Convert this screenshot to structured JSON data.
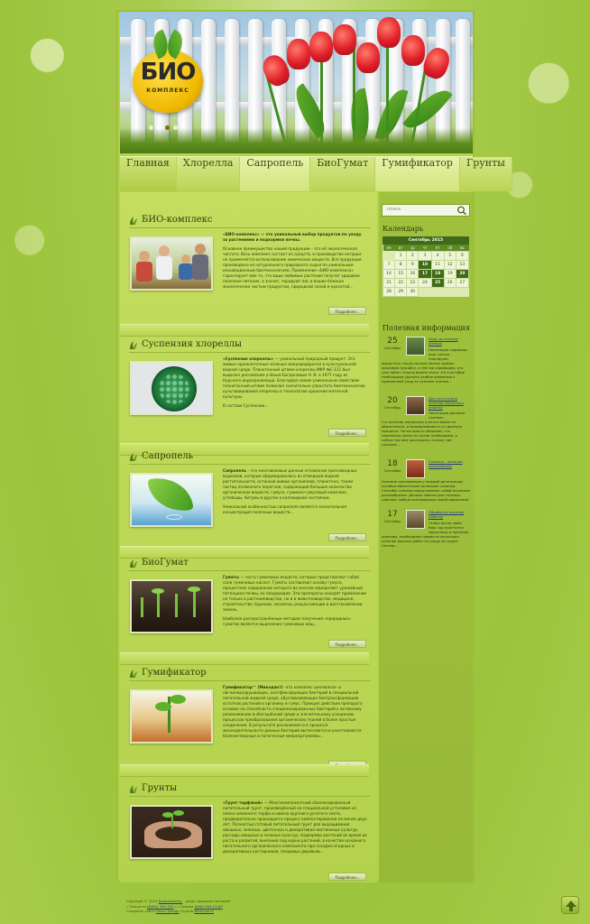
{
  "logo": {
    "text": "БИО",
    "subtext": "КОМПЛЕКС"
  },
  "nav": [
    "Главная",
    "Хлорелла",
    "Сапропель",
    "БиоГумат",
    "Гумификатор",
    "Грунты"
  ],
  "sections": [
    {
      "title": "БИО-комплекс",
      "lead": "«БИО-комплекс» — это уникальный выбор продуктов по уходу за растениями и подкормки почвы.",
      "body": "Основное преимущество нашей продукции – это её экологическая чистота. Весь комплекс состоит из средств, в производстве которых не применяется использование химических веществ. Вся продукция производена из натурального природного сырья по уникальным инновационным биотехнологиям. Применение «БИО-комплекса» гарантирует вам то, что ваши любимые растения получат здоровое полезное питание, а значит, порадуют вас и ваших близких экологически чистым продуктом, природной силой и красотой...",
      "more": "Подробнее..."
    },
    {
      "title": "Суспензия хлореллы",
      "lead": "«Суспензия хлореллы»",
      "body": " — уникальный природный продукт. Это живые одноклеточные зеленые микроводоросли в культуральной водной среде. Планктонный штамм хлореллы ИФР №С-111 был выделен российским учёным Богдановым Н. И. в 1977 году из Нурского водохранилища. Благодаря своим уникальным свойствам планктонный штамм позволил значительно упростить биотехнологию культивирования хлореллы и технологию хранения маточной культуры.",
      "body2": "В составе Суспензии...",
      "more": "Подробнее..."
    },
    {
      "title": "Сапропель",
      "lead": "Сапропель",
      "body": " – это многовековые донные отложения пресноводных водоемов, которые сформировались из отмершей водной растительности, останков живых организмов, планктона, также частиц почвенного перегноя, содержащий большое количество органических веществ, гумуса, гуминно-гумусовый комплекс, углеводы, битумы в другие в коллоидном состоянии.",
      "body2": "Уникальной особенностью сапропеля является значительная концентрация полезных веществ...",
      "more": "Подробнее..."
    },
    {
      "title": "БиоГумат",
      "lead": "Гуматы",
      "body": " — часть гуминовых веществ, которые представляют собой соли гуминовых кислот. Гуматы составляют основу гумуса, процентное содержание которого во многом определяет урожайный потенциал почвы, ее плодородие. Эти препараты находят применение не только в растениеводстве, но и в животноводстве, медицине, строительстве, бурении, экологии, рекультивации и восстановлении земель.",
      "body2": "Наиболее распространённым методом получения «природных» гуматов является выделение гуминовых вещ...",
      "more": "Подробнее..."
    },
    {
      "title": "Гумификатор",
      "lead": "Гумификатор™ (Микодакт)",
      "body": " –это комплекс целлюлозо- и лигниноразрушающих, азотфиксирующих бактерий в специальной питательной жидкой среде, обуславливающих биотрансформацию остатков растений в органику и гумус. Принцип действия препарата основан на способности специализированных бактерий к активному размножению в обогащённой среде и значительному ускорению процессов преобразования органических тканей в более простые соединения. В результате разложения и в процессе жизнедеятельности данных бактерий вытесняются и уничтожаются болезнетворные и патогенные микроорганизмы...",
      "more": "Подробнее..."
    },
    {
      "title": "Грунты",
      "lead": "«Грунт торфяной»",
      "body": " — Многокомпонентный сбалансированный питательный грунт, произведённый на специальной установке из смеси низинного торфа и навоза крупного рогатого скота, предварительно прошедшего процесс компостирования не менее двух лет. Полностью готовый питательный грунт для выращивания овощных, зеленых, цветочных и декоративно-лиственных культур, рассады овощных и зеленых культур, подкормки растений во время их роста и развития, внесения под корни растений, в качестве основного питательного органического компонента при посадки ягодных и декоративных кустарников, плодовых деревьев...",
      "more": "Подробнее..."
    }
  ],
  "sidebar": {
    "search_placeholder": "поиск",
    "calendar_title": "Календарь",
    "month": "Сентябрь 2015",
    "weekdays": [
      "пн",
      "вт",
      "ср",
      "чт",
      "пт",
      "сб",
      "вс"
    ],
    "weeks": [
      [
        "",
        "1",
        "2",
        "3",
        "4",
        "5",
        "6"
      ],
      [
        "7",
        "8",
        "9",
        "10",
        "11",
        "12",
        "13"
      ],
      [
        "14",
        "15",
        "16",
        "17",
        "18",
        "19",
        "20"
      ],
      [
        "21",
        "22",
        "23",
        "24",
        "25",
        "26",
        "27"
      ],
      [
        "28",
        "29",
        "30",
        "",
        "",
        "",
        ""
      ]
    ],
    "highlighted_days": [
      "10",
      "17",
      "18",
      "20",
      "25"
    ],
    "news_title": "Полезная информация",
    "news": [
      {
        "day": "25",
        "month": "Сентябрь",
        "title": "Уход за газоном осенью",
        "side": "Некоторые садоводы еще только планируют",
        "text": "вырастить такую сочную зелень домом красивую лужайку, а тем же садоводам, кто уже имеет газоны важно знать что в октябре необходимо уделить особое внимание к правильный уход за газоном осенью...",
        "color": "#7a9a4a"
      },
      {
        "day": "20",
        "month": "Сентябрь",
        "title": "Для чего нужна осенняя перекопка участка",
        "side": "Некоторые дачники считают,",
        "text": "что осенняя перекопка участка вовсе не обязательна, и воздерживаются от данного процесса. Но вы просто убедимы, что перекопка земли по осени необходима, и сейчас мы вам расскажем, почему так считаем...",
        "color": "#8a5a3a"
      },
      {
        "day": "18",
        "month": "Сентябрь",
        "title": "Соленья – осенние консервации",
        "side": "",
        "text": "Осенние консервация у каждой дачельницы хозяйки обязательно включают соленья. Способы соления представляют собой огромное разнообразие. Дачные советы для сольных сделают любую консервацию самой идеальной.",
        "color": "#b0442a"
      },
      {
        "day": "17",
        "month": "Сентябрь",
        "title": "Обработка осенних работах",
        "side": "Чтобы после зимы Ваш сад прогнулся двухочных и крепким,",
        "text": "крепким, необходимо провести несколько осенних важных работ по уходу за садом. Сентяр...",
        "color": "#8a7a5a"
      }
    ]
  },
  "footer": {
    "line1_pre": "Copyright © 2015",
    "line1_link": "Биокомплекс",
    "line1_post": "- ваше здоровое питание!",
    "line2_pre": "г.Тольятти",
    "line2_phone1": "(8482) 280-420",
    "line2_mid": "г.Самара",
    "line2_phone2": "(846) 990-13-83",
    "line3_pre": "Создание сайта",
    "line3_link1": "Decor Design",
    "line3_mid": "Группа",
    "line3_link2": "ВКонтакте"
  },
  "colors": {
    "accent": "#3f6a17",
    "background": "#a7cb4c",
    "link": "#233a85"
  }
}
